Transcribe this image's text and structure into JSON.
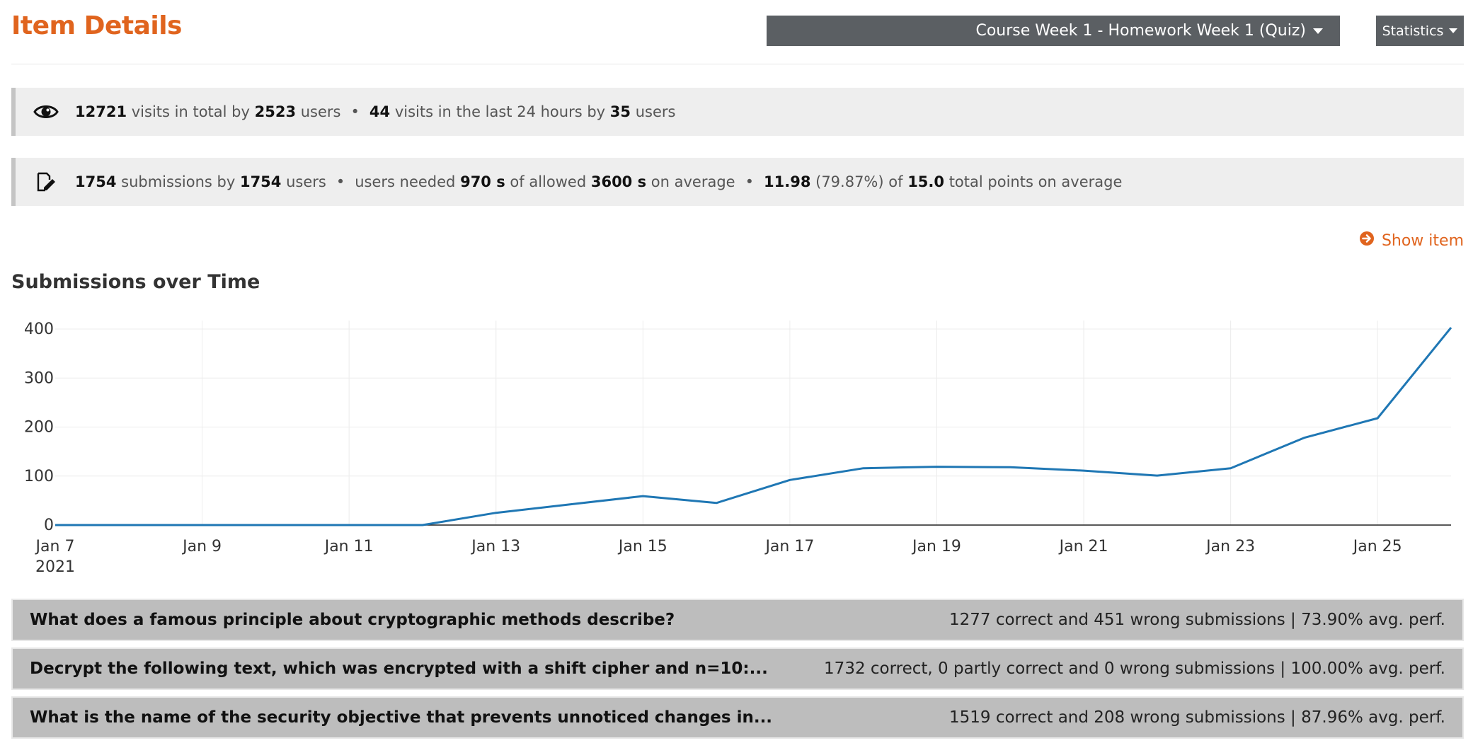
{
  "header": {
    "title": "Item Details",
    "course_dropdown": "Course Week 1 - Homework Week 1 (Quiz)",
    "stats_dropdown": "Statistics"
  },
  "visits": {
    "total": "12721",
    "t1": "visits in total by",
    "users": "2523",
    "t2": "users",
    "last24": "44",
    "t3": "visits in the last 24 hours by",
    "last24_users": "35",
    "t4": "users"
  },
  "submissions": {
    "count": "1754",
    "t1": "submissions by",
    "users": "1754",
    "t2": "users",
    "t3": "users needed",
    "needed": "970 s",
    "t4": "of allowed",
    "allowed": "3600 s",
    "t5": "on average",
    "score": "11.98",
    "pct": "(79.87%) of",
    "total_points": "15.0",
    "t6": "total points on average"
  },
  "show_item_label": "Show item",
  "section_title": "Submissions over Time",
  "chart_data": {
    "type": "line",
    "ylim": [
      0,
      400
    ],
    "y_ticks": [
      "0",
      "100",
      "200",
      "300",
      "400"
    ],
    "x_ticks": [
      "Jan 7",
      "Jan 9",
      "Jan 11",
      "Jan 13",
      "Jan 15",
      "Jan 17",
      "Jan 19",
      "Jan 21",
      "Jan 23",
      "Jan 25"
    ],
    "x_tick_year": "2021",
    "x": [
      "Jan 7",
      "Jan 8",
      "Jan 9",
      "Jan 10",
      "Jan 11",
      "Jan 12",
      "Jan 13",
      "Jan 14",
      "Jan 15",
      "Jan 16",
      "Jan 17",
      "Jan 18",
      "Jan 19",
      "Jan 20",
      "Jan 21",
      "Jan 22",
      "Jan 23",
      "Jan 24",
      "Jan 25",
      "Jan 26"
    ],
    "values": [
      0,
      0,
      0,
      0,
      0,
      0,
      25,
      42,
      59,
      45,
      92,
      116,
      119,
      118,
      111,
      101,
      116,
      178,
      218,
      403
    ],
    "line_color": "#1f77b4",
    "grid": true
  },
  "questions": [
    {
      "text": "What does a famous principle about cryptographic methods describe?",
      "perf": "1277 correct and 451 wrong submissions | 73.90% avg. perf."
    },
    {
      "text": "Decrypt the following text, which was encrypted with a shift cipher and n=10:...",
      "perf": "1732 correct, 0 partly correct and 0 wrong submissions | 100.00% avg. perf."
    },
    {
      "text": "What is the name of the security objective that prevents unnoticed changes in...",
      "perf": "1519 correct and 208 wrong submissions | 87.96% avg. perf."
    }
  ]
}
